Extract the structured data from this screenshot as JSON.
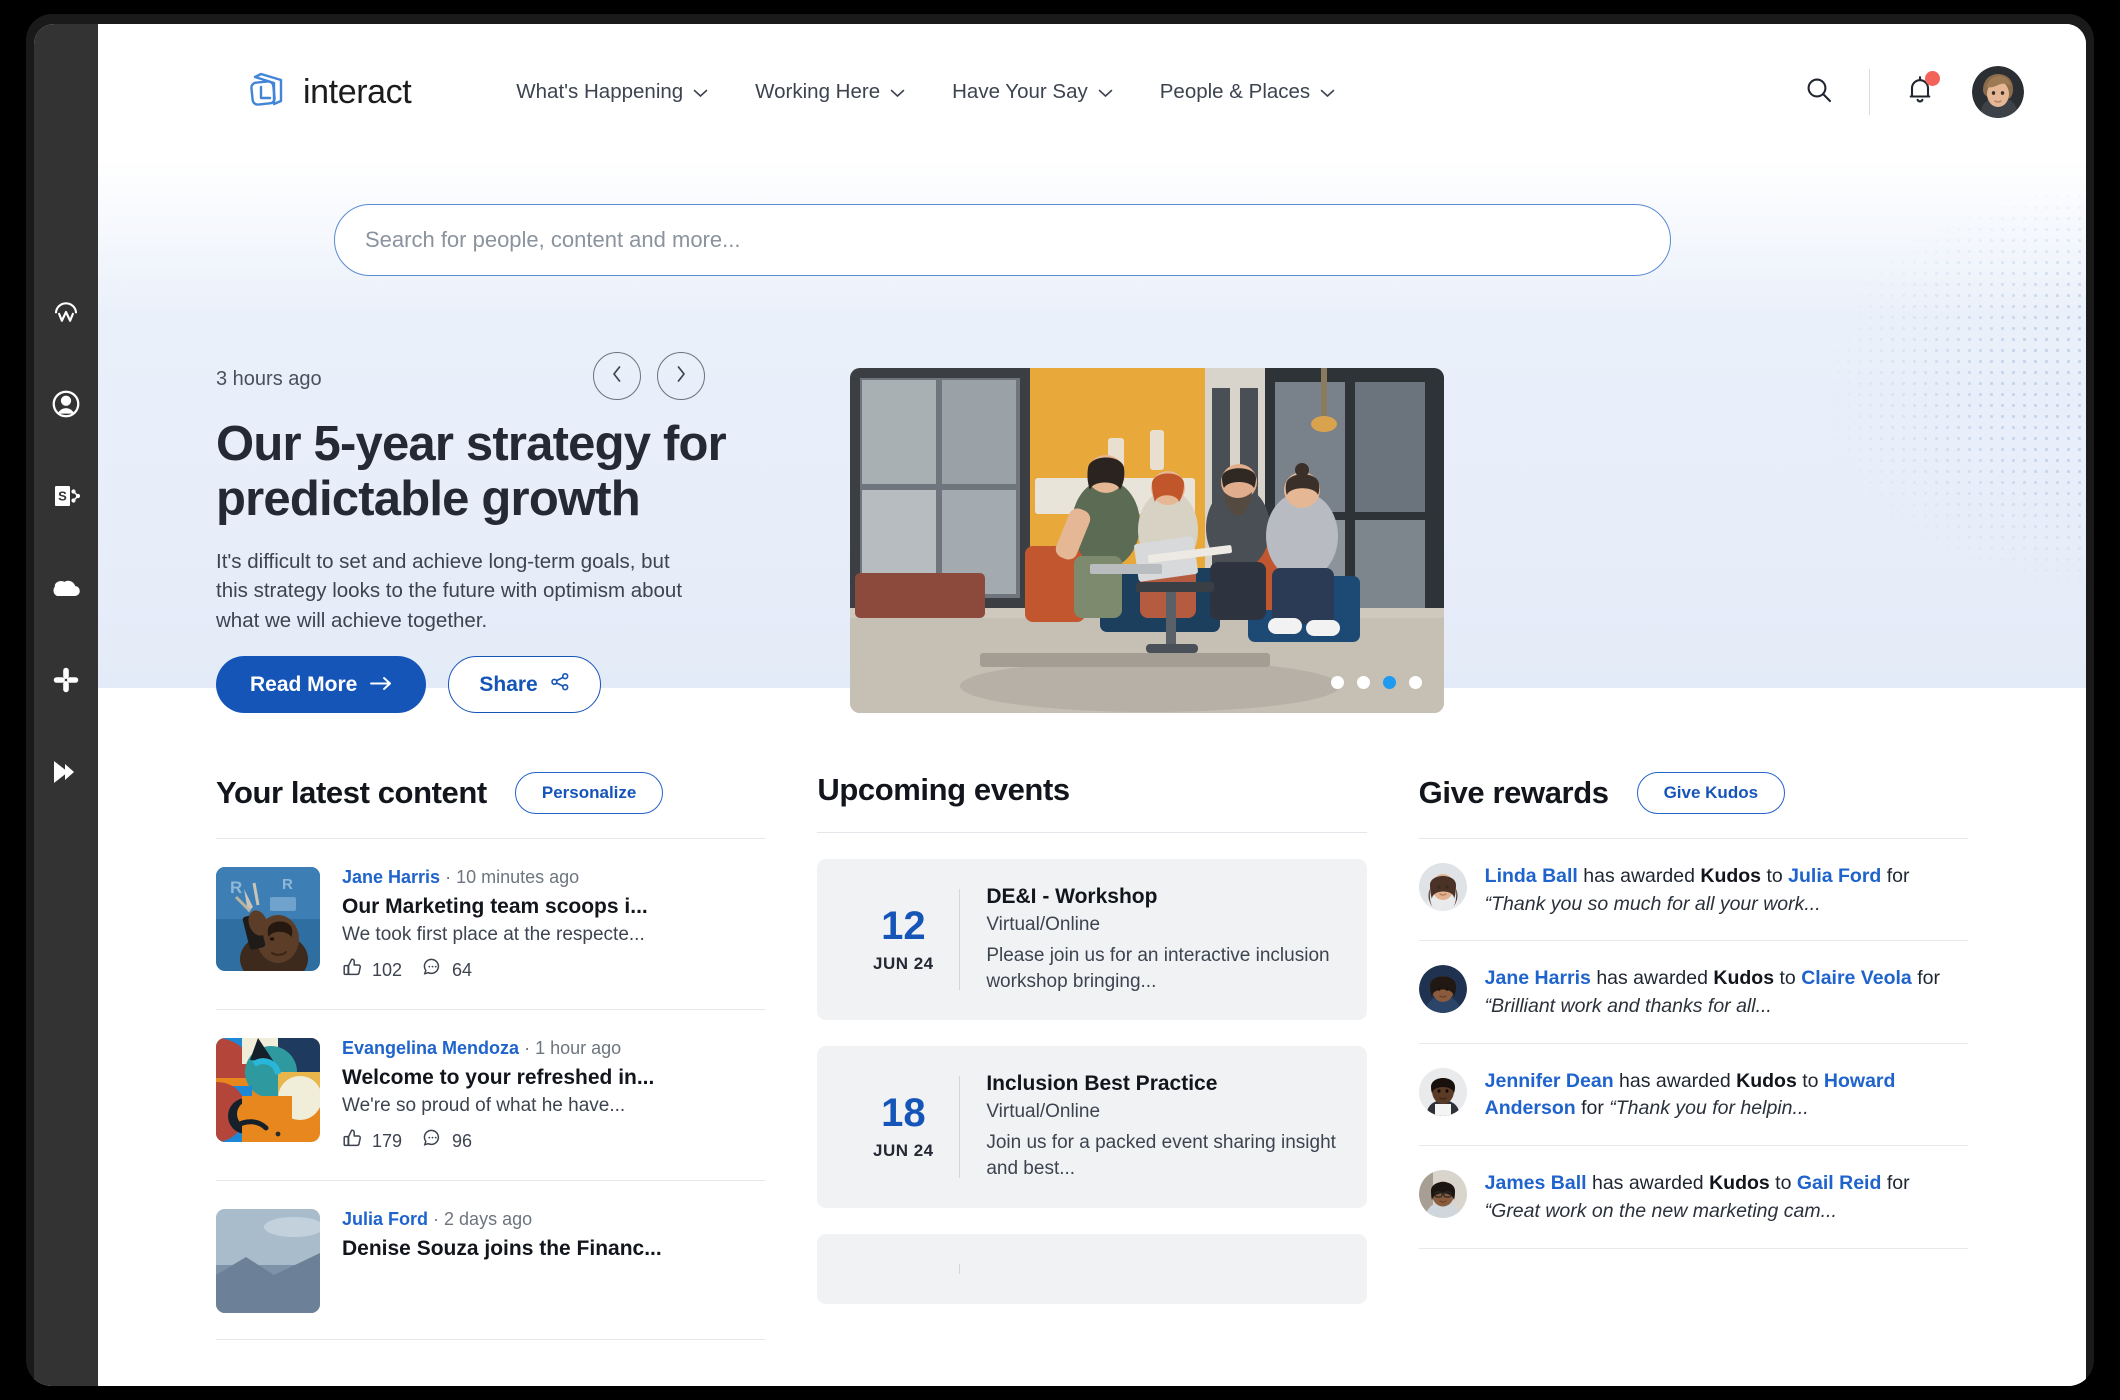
{
  "brand": {
    "name": "interact",
    "primary": "#1655B8",
    "link": "#1f63cc",
    "badge": "#F2645A",
    "dot_active": "#1E9BF0"
  },
  "rail": {
    "items": [
      {
        "icon": "workday-icon",
        "label": "Workday"
      },
      {
        "icon": "profile-icon",
        "label": "Profile"
      },
      {
        "icon": "sharepoint-icon",
        "label": "SharePoint"
      },
      {
        "icon": "onedrive-cloud-icon",
        "label": "OneDrive"
      },
      {
        "icon": "slack-icon",
        "label": "Slack"
      },
      {
        "icon": "play-forward-icon",
        "label": "Media"
      }
    ]
  },
  "header": {
    "nav": [
      {
        "label": "What's Happening"
      },
      {
        "label": "Working Here"
      },
      {
        "label": "Have Your Say"
      },
      {
        "label": "People & Places"
      }
    ],
    "search_icon": "search-icon",
    "notifications_icon": "bell-icon",
    "has_notification": true,
    "avatar": "user-avatar"
  },
  "search": {
    "placeholder": "Search for people, content and more...",
    "value": ""
  },
  "hero": {
    "time": "3 hours ago",
    "title": "Our 5-year strategy for predictable growth",
    "description": "It's difficult to set and achieve long-term goals, but this strategy looks to the future with optimism about what we will achieve together.",
    "read_more": "Read More",
    "share": "Share",
    "prev_icon": "chevron-left-icon",
    "next_icon": "chevron-right-icon",
    "slides": 4,
    "active_slide": 3
  },
  "latest": {
    "title": "Your latest content",
    "action": "Personalize",
    "posts": [
      {
        "author": "Jane Harris",
        "time": "10 minutes ago",
        "title": "Our Marketing team scoops i...",
        "excerpt": "We took first place at the respecte...",
        "likes": "102",
        "comments": "64"
      },
      {
        "author": "Evangelina Mendoza",
        "time": "1 hour ago",
        "title": "Welcome to your refreshed in...",
        "excerpt": "We're so proud of what he have...",
        "likes": "179",
        "comments": "96"
      },
      {
        "author": "Julia Ford",
        "time": "2 days ago",
        "title": "Denise Souza joins the Financ...",
        "excerpt": "",
        "likes": "",
        "comments": ""
      }
    ]
  },
  "events": {
    "title": "Upcoming events",
    "items": [
      {
        "day": "12",
        "month": "JUN 24",
        "title": "DE&I - Workshop",
        "location": "Virtual/Online",
        "description": "Please join us for an interactive inclusion workshop bringing..."
      },
      {
        "day": "18",
        "month": "JUN 24",
        "title": "Inclusion Best Practice",
        "location": "Virtual/Online",
        "description": "Join us for a packed event sharing insight and best..."
      },
      {
        "day": "",
        "month": "",
        "title": "",
        "location": "",
        "description": ""
      }
    ]
  },
  "rewards": {
    "title": "Give rewards",
    "action": "Give Kudos",
    "items": [
      {
        "giver": "Linda Ball",
        "verb": "has awarded",
        "award": "Kudos",
        "to": "to",
        "receiver": "Julia Ford",
        "for": "for",
        "quote": "“Thank you so much for all your work..."
      },
      {
        "giver": "Jane Harris",
        "verb": "has awarded",
        "award": "Kudos",
        "to": "to",
        "receiver": "Claire Veola",
        "for": "for",
        "quote": "“Brilliant work and thanks for all..."
      },
      {
        "giver": "Jennifer Dean",
        "verb": "has awarded",
        "award": "Kudos",
        "to": "to",
        "receiver": "Howard Anderson",
        "for": "for",
        "quote": "“Thank you for helpin..."
      },
      {
        "giver": "James Ball",
        "verb": "has awarded",
        "award": "Kudos",
        "to": "to",
        "receiver": "Gail Reid",
        "for": "for",
        "quote": "“Great work on the new marketing cam..."
      }
    ]
  }
}
